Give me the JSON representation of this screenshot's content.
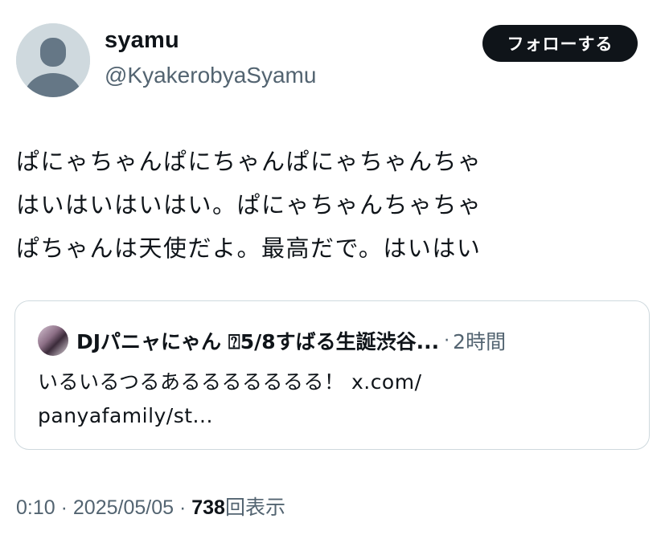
{
  "author": {
    "display_name": "syamu",
    "handle": "@KyakerobyaSyamu",
    "avatar_icon": "default-avatar-icon"
  },
  "follow_button": {
    "label": "フォローする"
  },
  "tweet": {
    "lines": [
      "ぱにゃちゃんぱにちゃんぱにゃちゃんちゃ",
      "はいはいはいはい。ぱにゃちゃんちゃちゃ",
      "ぱちゃんは天使だよ。最高だで。はいはい"
    ]
  },
  "quote": {
    "author_name": "DJパニャにゃん ⍰5/8すばる生誕渋谷...",
    "separator": "·",
    "time": "2時間",
    "lines": [
      "いるいるつるあるるるるるるる！ x.com/",
      "panyafamily/st..."
    ]
  },
  "meta": {
    "time": "0:10",
    "sep1": " · ",
    "date": "2025/05/05",
    "sep2": " · ",
    "views": "738",
    "views_label": "回表示"
  },
  "colors": {
    "text": "#0f1419",
    "secondary": "#536471",
    "border": "#cfd9de",
    "button_bg": "#0f1419"
  }
}
